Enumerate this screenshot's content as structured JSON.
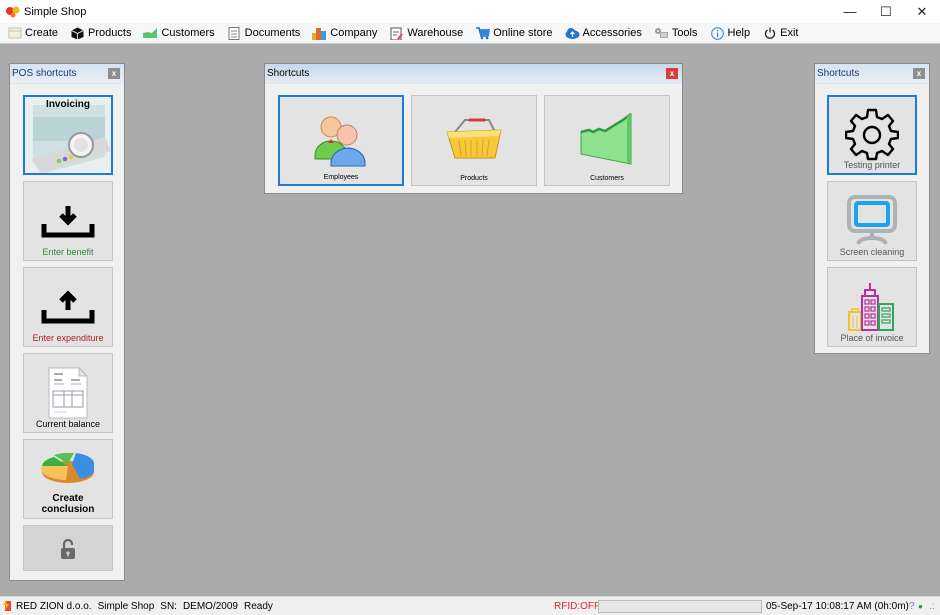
{
  "window": {
    "title": "Simple Shop",
    "controls": {
      "minimize": "—",
      "maximize": "☐",
      "close": "✕"
    }
  },
  "menu": [
    {
      "label": "Create",
      "icon": "create-icon"
    },
    {
      "label": "Products",
      "icon": "products-box-icon"
    },
    {
      "label": "Customers",
      "icon": "customers-chart-icon"
    },
    {
      "label": "Documents",
      "icon": "documents-icon"
    },
    {
      "label": "Company",
      "icon": "company-buildings-icon"
    },
    {
      "label": "Warehouse",
      "icon": "warehouse-clipboard-icon"
    },
    {
      "label": "Online store",
      "icon": "cart-icon"
    },
    {
      "label": "Accessories",
      "icon": "cloud-upload-icon"
    },
    {
      "label": "Tools",
      "icon": "tools-icon"
    },
    {
      "label": "Help",
      "icon": "info-icon"
    },
    {
      "label": "Exit",
      "icon": "power-icon"
    }
  ],
  "pos_panel": {
    "title": "POS shortcuts",
    "close": "x",
    "tiles": [
      {
        "label": "Invoicing",
        "icon": "cash-register-icon",
        "selected": true
      },
      {
        "label": "Enter benefit",
        "icon": "download-tray-icon",
        "color": "#2e8b2e"
      },
      {
        "label": "Enter expenditure",
        "icon": "upload-tray-icon",
        "color": "#b22222"
      },
      {
        "label": "Current balance",
        "icon": "invoice-document-icon"
      },
      {
        "label": "Create conclusion",
        "icon": "pie-chart-icon"
      },
      {
        "label": "",
        "icon": "unlock-icon"
      }
    ]
  },
  "shortcuts_window": {
    "title": "Shortcuts",
    "close": "x",
    "tiles": [
      {
        "label": "Employees",
        "icon": "employees-icon",
        "selected": true
      },
      {
        "label": "Products",
        "icon": "basket-icon"
      },
      {
        "label": "Customers",
        "icon": "growth-chart-icon"
      }
    ]
  },
  "right_panel": {
    "title": "Shortcuts",
    "close": "x",
    "tiles": [
      {
        "label": "Testing printer",
        "icon": "gear-icon",
        "selected": true
      },
      {
        "label": "Screen cleaning",
        "icon": "monitor-icon"
      },
      {
        "label": "Place of invoice",
        "icon": "buildings-icon"
      }
    ]
  },
  "statusbar": {
    "company": "RED ZION d.o.o.",
    "app": "Simple Shop",
    "sn_label": "SN:",
    "sn": "DEMO/2009",
    "status": "Ready",
    "rfid": "RFID:OFF",
    "datetime": "05-Sep-17 10:08:17 AM (0h:0m)",
    "help": "?",
    "dot": "●",
    "grip": ".:"
  },
  "colors": {
    "accent_selected": "#1e7bd6",
    "rfid_off": "#e0242a",
    "benefit_green": "#2e8b2e",
    "expenditure_red": "#b22222"
  }
}
